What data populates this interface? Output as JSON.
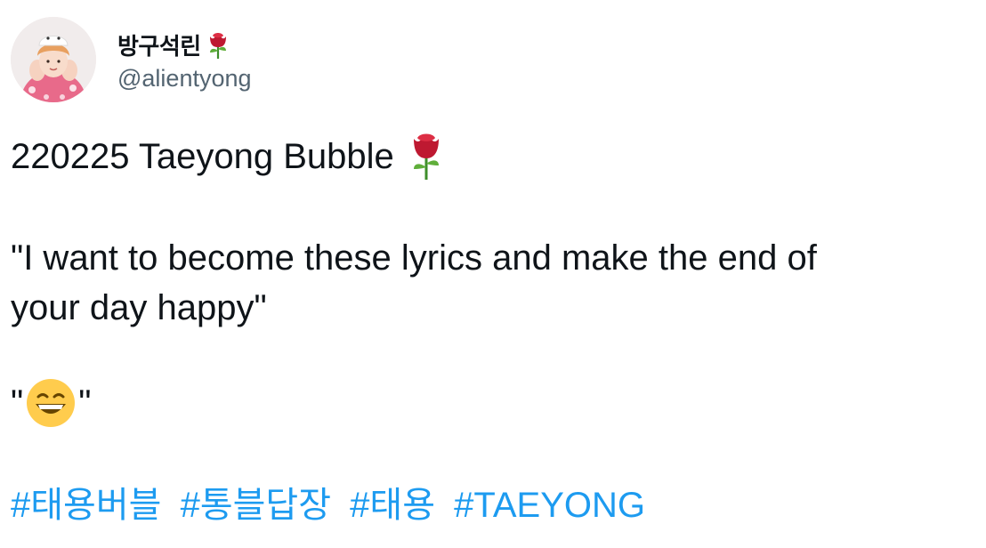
{
  "author": {
    "display_name": "방구석린",
    "name_emoji": "rose-emoji",
    "handle": "@alientyong",
    "avatar": "avatar-photo"
  },
  "tweet": {
    "line1_text": "220225 Taeyong Bubble",
    "line1_emoji": "rose-emoji",
    "quote_line1": "\"I want to become these lyrics and make the end of",
    "quote_line2": "your day happy\"",
    "emoji_quote_open": "\"",
    "emoji_quote_emoji": "grinning-squinting-face-emoji",
    "emoji_quote_close": "\"",
    "hashtags": [
      "#태용버블",
      "#통블답장",
      "#태용",
      "#TAEYONG"
    ]
  },
  "colors": {
    "text": "#0f1419",
    "secondary": "#536471",
    "link": "#1d9bf0"
  }
}
